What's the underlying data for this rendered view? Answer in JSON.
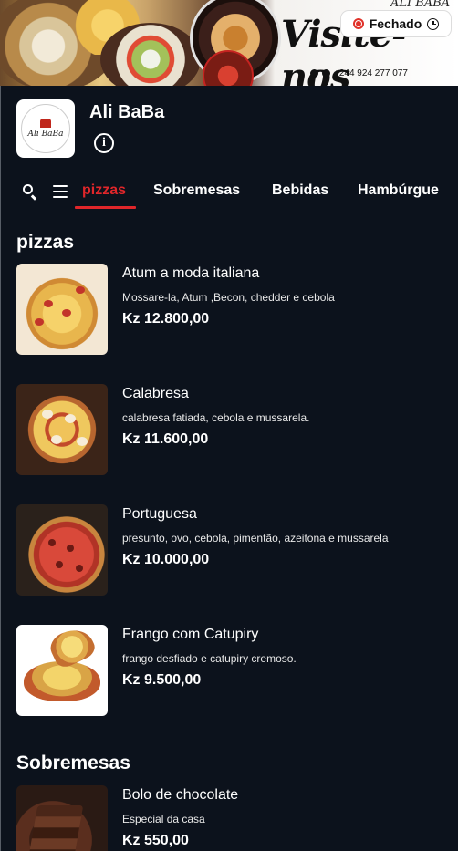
{
  "banner": {
    "brand_small": "ALI BABA",
    "headline": "Visite-nos",
    "phone": "+244 924 277 077",
    "status": "Fechado"
  },
  "restaurant": {
    "name": "Ali BaBa",
    "logo_text": "Ali BaBa"
  },
  "tabs": [
    {
      "label": "pizzas",
      "active": true
    },
    {
      "label": "Sobremesas",
      "active": false
    },
    {
      "label": "Bebidas",
      "active": false
    },
    {
      "label": "Hambúrgue",
      "active": false
    }
  ],
  "sections": [
    {
      "title": "pizzas",
      "items": [
        {
          "name": "Atum a moda italiana",
          "description": "Mossare-la, Atum ,Becon, chedder e cebola",
          "price": "Kz 12.800,00"
        },
        {
          "name": "Calabresa",
          "description": "calabresa fatiada, cebola e mussarela.",
          "price": "Kz 11.600,00"
        },
        {
          "name": "Portuguesa",
          "description": "presunto, ovo, cebola, pimentão, azeitona e mussarela",
          "price": "Kz 10.000,00"
        },
        {
          "name": "Frango com Catupiry",
          "description": "frango desfiado e catupiry cremoso.",
          "price": "Kz 9.500,00"
        }
      ]
    },
    {
      "title": "Sobremesas",
      "items": [
        {
          "name": "Bolo de chocolate",
          "description": "Especial da casa",
          "price": "Kz 550,00"
        }
      ]
    }
  ],
  "colors": {
    "background": "#0c121c",
    "accent": "#e0262a",
    "text": "#ffffff"
  },
  "icons": [
    "clock-icon",
    "status-dot-icon",
    "info-icon",
    "search-icon",
    "menu-icon"
  ]
}
